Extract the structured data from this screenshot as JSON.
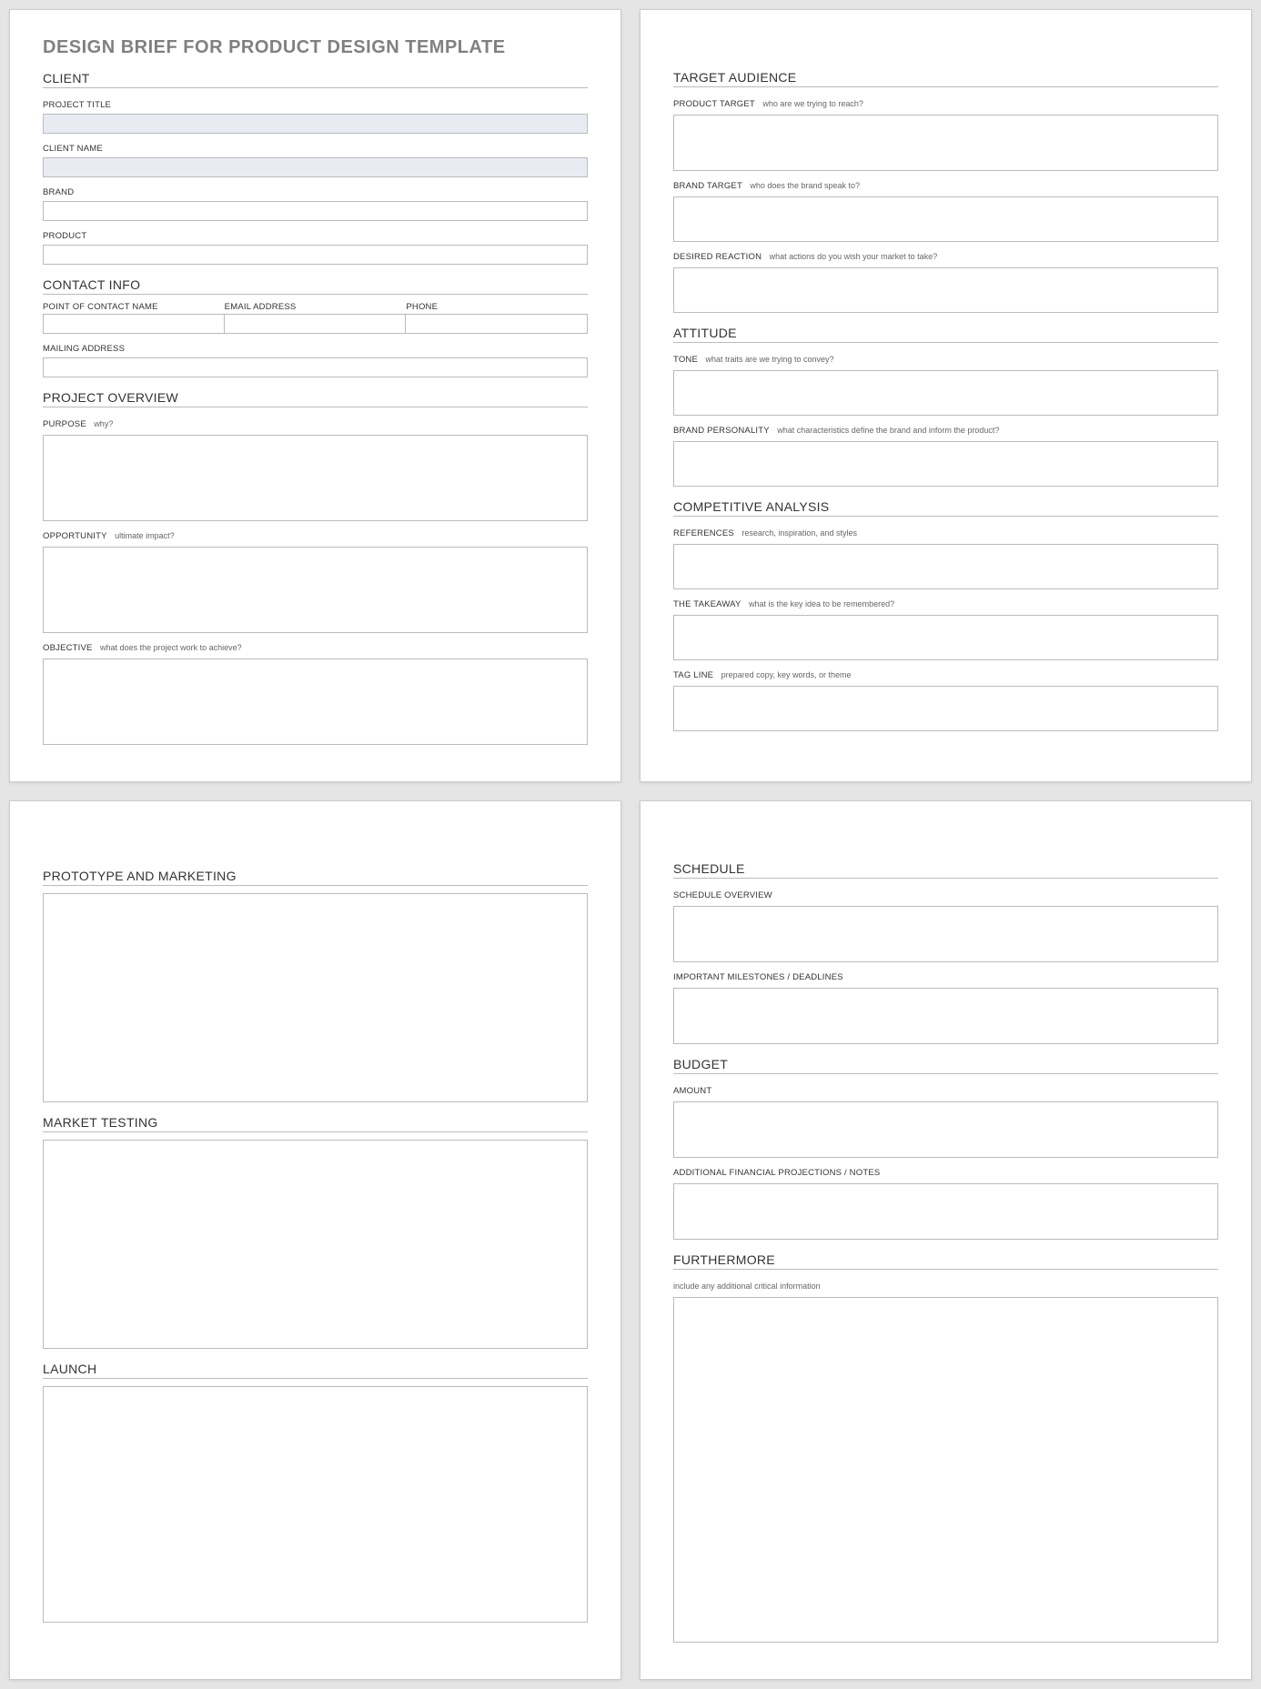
{
  "title": "DESIGN BRIEF FOR PRODUCT DESIGN TEMPLATE",
  "page1": {
    "client": {
      "heading": "CLIENT",
      "projectTitle": "PROJECT TITLE",
      "clientName": "CLIENT NAME",
      "brand": "BRAND",
      "product": "PRODUCT"
    },
    "contactInfo": {
      "heading": "CONTACT INFO",
      "pocName": "POINT OF CONTACT NAME",
      "email": "EMAIL ADDRESS",
      "phone": "PHONE",
      "mailing": "MAILING ADDRESS"
    },
    "projectOverview": {
      "heading": "PROJECT OVERVIEW",
      "purpose": "PURPOSE",
      "purposeHint": "why?",
      "opportunity": "OPPORTUNITY",
      "opportunityHint": "ultimate impact?",
      "objective": "OBJECTIVE",
      "objectiveHint": "what does the project work to achieve?"
    }
  },
  "page2": {
    "targetAudience": {
      "heading": "TARGET AUDIENCE",
      "productTarget": "PRODUCT TARGET",
      "productTargetHint": "who are we trying to reach?",
      "brandTarget": "BRAND TARGET",
      "brandTargetHint": "who does the brand speak to?",
      "desiredReaction": "DESIRED REACTION",
      "desiredReactionHint": "what actions do you wish your market to take?"
    },
    "attitude": {
      "heading": "ATTITUDE",
      "tone": "TONE",
      "toneHint": "what traits are we trying to convey?",
      "brandPersonality": "BRAND PERSONALITY",
      "brandPersonalityHint": "what characteristics define the brand and inform the product?"
    },
    "competitive": {
      "heading": "COMPETITIVE ANALYSIS",
      "references": "REFERENCES",
      "referencesHint": "research, inspiration, and styles",
      "takeaway": "THE TAKEAWAY",
      "takeawayHint": "what is the key idea to be remembered?",
      "tagline": "TAG LINE",
      "taglineHint": "prepared copy, key words, or theme"
    }
  },
  "page3": {
    "prototypeMarketing": "PROTOTYPE AND MARKETING",
    "marketTesting": "MARKET TESTING",
    "launch": "LAUNCH"
  },
  "page4": {
    "schedule": {
      "heading": "SCHEDULE",
      "overview": "SCHEDULE OVERVIEW",
      "milestones": "IMPORTANT MILESTONES / DEADLINES"
    },
    "budget": {
      "heading": "BUDGET",
      "amount": "AMOUNT",
      "additional": "ADDITIONAL FINANCIAL PROJECTIONS / NOTES"
    },
    "furthermore": {
      "heading": "FURTHERMORE",
      "hint": "include any additional critical information"
    }
  }
}
